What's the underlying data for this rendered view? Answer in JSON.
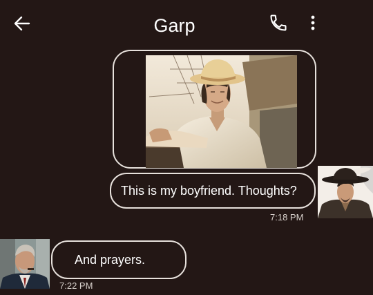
{
  "header": {
    "title": "Garp",
    "back_icon": "arrow-left-icon",
    "call_icon": "phone-icon",
    "more_icon": "more-vert-icon"
  },
  "messages": {
    "outgoing": {
      "text": "This is my boyfriend. Thoughts?",
      "time": "7:18 PM"
    },
    "incoming": {
      "text": "And prayers.",
      "time": "7:22 PM"
    }
  },
  "colors": {
    "background": "#231715",
    "bubble_border": "#e7e1dc",
    "text": "#ffffff"
  }
}
